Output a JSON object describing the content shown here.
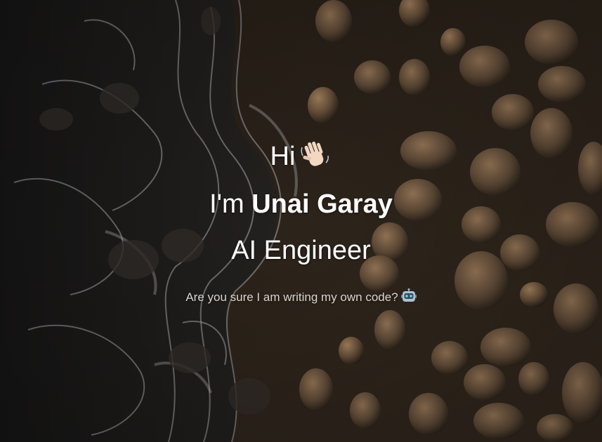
{
  "hero": {
    "greeting": "Hi",
    "greeting_emoji": "waving-hand-icon",
    "intro_prefix": "I'm",
    "name": "Unai Garay",
    "role": "AI Engineer",
    "tagline": "Are you sure I am writing my own code?",
    "tagline_emoji": "robot-icon"
  },
  "colors": {
    "text": "#ffffff",
    "tagline": "#d9d4cf",
    "sand": "#3a2e22",
    "foam": "#c9cbcf",
    "rock": "#8a6f55"
  }
}
